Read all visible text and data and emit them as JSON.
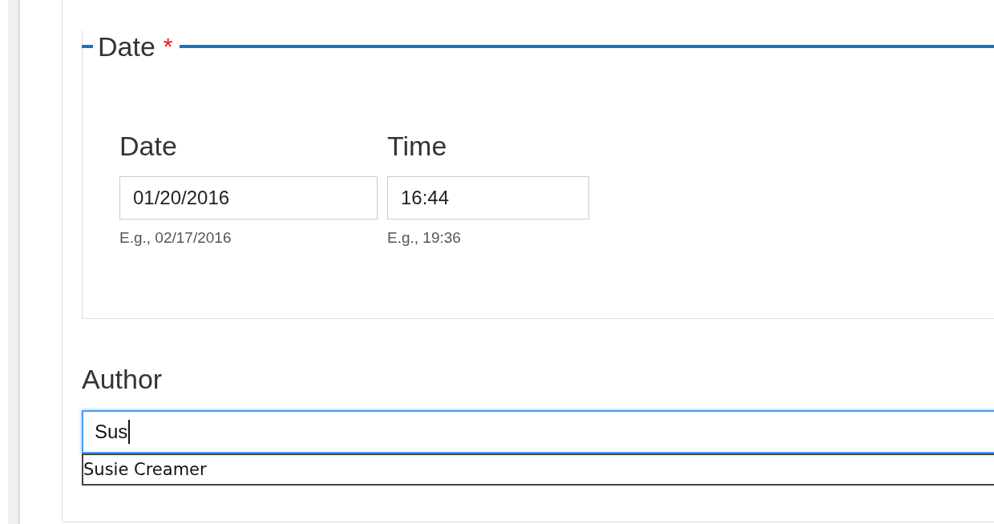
{
  "fieldset": {
    "legend": "Date",
    "required": true,
    "required_mark": "*",
    "fields": [
      {
        "label": "Date",
        "value": "01/20/2016",
        "hint": "E.g., 02/17/2016"
      },
      {
        "label": "Time",
        "value": "16:44",
        "hint": "E.g., 19:36"
      }
    ]
  },
  "author": {
    "label": "Author",
    "value": "Sus",
    "focused": true,
    "suggestions": [
      {
        "text": "Susie Creamer"
      }
    ]
  }
}
